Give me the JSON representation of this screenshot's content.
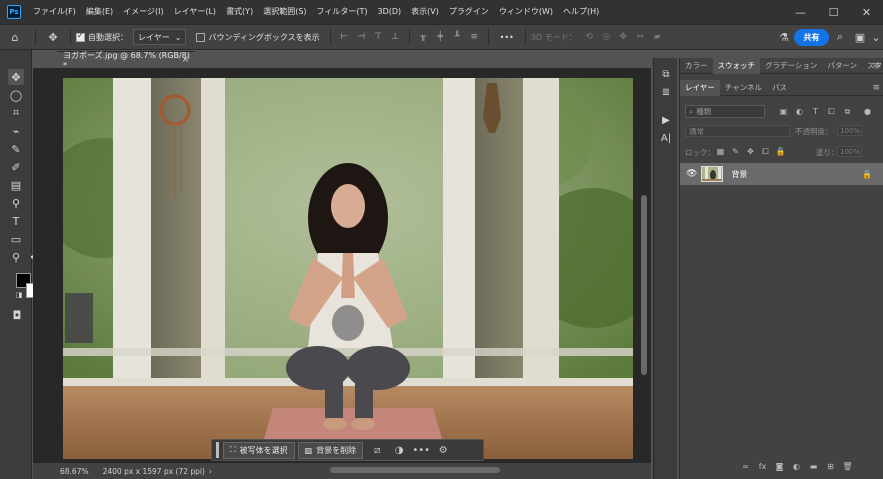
{
  "app": {
    "logo": "Ps",
    "menu": [
      "ファイル(F)",
      "編集(E)",
      "イメージ(I)",
      "レイヤー(L)",
      "書式(Y)",
      "選択範囲(S)",
      "フィルター(T)",
      "3D(D)",
      "表示(V)",
      "プラグイン",
      "ウィンドウ(W)",
      "ヘルプ(H)"
    ],
    "window_controls": [
      "—",
      "☐",
      "✕"
    ]
  },
  "options_bar": {
    "auto_select_label": "自動選択：",
    "auto_select_checked": true,
    "auto_select_target": "レイヤー",
    "bounding_box_label": "バウンディングボックスを表示",
    "bounding_box_checked": false,
    "more_label": "•••",
    "mode_3d_label": "3D モード：",
    "share_label": "共有"
  },
  "document": {
    "tab_title": "ヨガポーズ.jpg @ 68.7% (RGB/8) *",
    "close": "×",
    "zoom": "68.67%",
    "info": "2400 px x 1597 px (72 ppi)"
  },
  "context_bar": {
    "select_subject": "被写体を選択",
    "remove_background": "背景を削除",
    "more": "•••"
  },
  "panels": {
    "top_tabs": [
      "カラー",
      "スウォッチ",
      "グラデーション",
      "パターン",
      "スタイル"
    ],
    "top_active": 1,
    "layer_tabs": [
      "レイヤー",
      "チャンネル",
      "パス"
    ],
    "layer_active": 0,
    "filter_placeholder": "種類",
    "blend_mode": "通常",
    "opacity_label": "不透明度：",
    "opacity_value": "100%",
    "lock_label": "ロック：",
    "fill_label": "塗り：",
    "fill_value": "100%",
    "layers": [
      {
        "name": "背景",
        "visible": true,
        "locked": true
      }
    ]
  },
  "colors": {
    "accent": "#1473e6",
    "foreground": "#000000",
    "background": "#ffffff"
  }
}
